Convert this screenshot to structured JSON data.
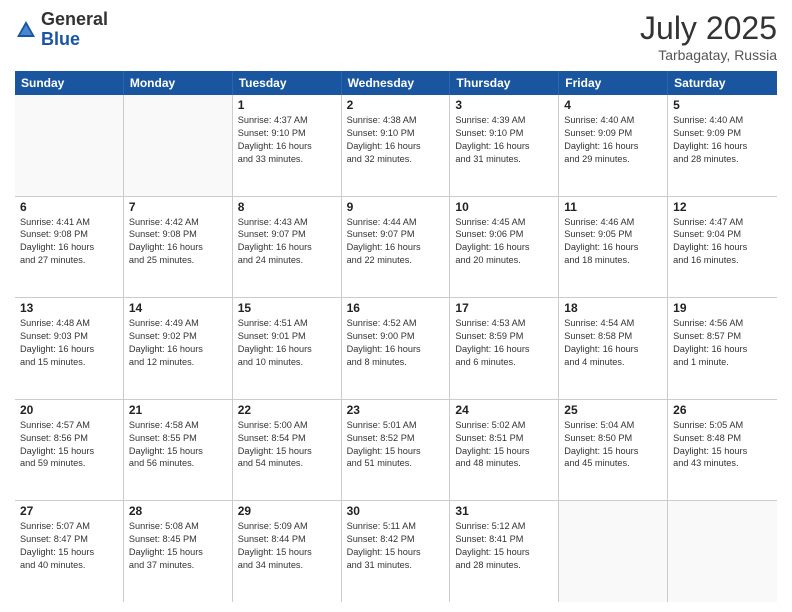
{
  "header": {
    "logo_general": "General",
    "logo_blue": "Blue",
    "month": "July 2025",
    "location": "Tarbagatay, Russia"
  },
  "days_of_week": [
    "Sunday",
    "Monday",
    "Tuesday",
    "Wednesday",
    "Thursday",
    "Friday",
    "Saturday"
  ],
  "weeks": [
    [
      {
        "day": "",
        "lines": []
      },
      {
        "day": "",
        "lines": []
      },
      {
        "day": "1",
        "lines": [
          "Sunrise: 4:37 AM",
          "Sunset: 9:10 PM",
          "Daylight: 16 hours",
          "and 33 minutes."
        ]
      },
      {
        "day": "2",
        "lines": [
          "Sunrise: 4:38 AM",
          "Sunset: 9:10 PM",
          "Daylight: 16 hours",
          "and 32 minutes."
        ]
      },
      {
        "day": "3",
        "lines": [
          "Sunrise: 4:39 AM",
          "Sunset: 9:10 PM",
          "Daylight: 16 hours",
          "and 31 minutes."
        ]
      },
      {
        "day": "4",
        "lines": [
          "Sunrise: 4:40 AM",
          "Sunset: 9:09 PM",
          "Daylight: 16 hours",
          "and 29 minutes."
        ]
      },
      {
        "day": "5",
        "lines": [
          "Sunrise: 4:40 AM",
          "Sunset: 9:09 PM",
          "Daylight: 16 hours",
          "and 28 minutes."
        ]
      }
    ],
    [
      {
        "day": "6",
        "lines": [
          "Sunrise: 4:41 AM",
          "Sunset: 9:08 PM",
          "Daylight: 16 hours",
          "and 27 minutes."
        ]
      },
      {
        "day": "7",
        "lines": [
          "Sunrise: 4:42 AM",
          "Sunset: 9:08 PM",
          "Daylight: 16 hours",
          "and 25 minutes."
        ]
      },
      {
        "day": "8",
        "lines": [
          "Sunrise: 4:43 AM",
          "Sunset: 9:07 PM",
          "Daylight: 16 hours",
          "and 24 minutes."
        ]
      },
      {
        "day": "9",
        "lines": [
          "Sunrise: 4:44 AM",
          "Sunset: 9:07 PM",
          "Daylight: 16 hours",
          "and 22 minutes."
        ]
      },
      {
        "day": "10",
        "lines": [
          "Sunrise: 4:45 AM",
          "Sunset: 9:06 PM",
          "Daylight: 16 hours",
          "and 20 minutes."
        ]
      },
      {
        "day": "11",
        "lines": [
          "Sunrise: 4:46 AM",
          "Sunset: 9:05 PM",
          "Daylight: 16 hours",
          "and 18 minutes."
        ]
      },
      {
        "day": "12",
        "lines": [
          "Sunrise: 4:47 AM",
          "Sunset: 9:04 PM",
          "Daylight: 16 hours",
          "and 16 minutes."
        ]
      }
    ],
    [
      {
        "day": "13",
        "lines": [
          "Sunrise: 4:48 AM",
          "Sunset: 9:03 PM",
          "Daylight: 16 hours",
          "and 15 minutes."
        ]
      },
      {
        "day": "14",
        "lines": [
          "Sunrise: 4:49 AM",
          "Sunset: 9:02 PM",
          "Daylight: 16 hours",
          "and 12 minutes."
        ]
      },
      {
        "day": "15",
        "lines": [
          "Sunrise: 4:51 AM",
          "Sunset: 9:01 PM",
          "Daylight: 16 hours",
          "and 10 minutes."
        ]
      },
      {
        "day": "16",
        "lines": [
          "Sunrise: 4:52 AM",
          "Sunset: 9:00 PM",
          "Daylight: 16 hours",
          "and 8 minutes."
        ]
      },
      {
        "day": "17",
        "lines": [
          "Sunrise: 4:53 AM",
          "Sunset: 8:59 PM",
          "Daylight: 16 hours",
          "and 6 minutes."
        ]
      },
      {
        "day": "18",
        "lines": [
          "Sunrise: 4:54 AM",
          "Sunset: 8:58 PM",
          "Daylight: 16 hours",
          "and 4 minutes."
        ]
      },
      {
        "day": "19",
        "lines": [
          "Sunrise: 4:56 AM",
          "Sunset: 8:57 PM",
          "Daylight: 16 hours",
          "and 1 minute."
        ]
      }
    ],
    [
      {
        "day": "20",
        "lines": [
          "Sunrise: 4:57 AM",
          "Sunset: 8:56 PM",
          "Daylight: 15 hours",
          "and 59 minutes."
        ]
      },
      {
        "day": "21",
        "lines": [
          "Sunrise: 4:58 AM",
          "Sunset: 8:55 PM",
          "Daylight: 15 hours",
          "and 56 minutes."
        ]
      },
      {
        "day": "22",
        "lines": [
          "Sunrise: 5:00 AM",
          "Sunset: 8:54 PM",
          "Daylight: 15 hours",
          "and 54 minutes."
        ]
      },
      {
        "day": "23",
        "lines": [
          "Sunrise: 5:01 AM",
          "Sunset: 8:52 PM",
          "Daylight: 15 hours",
          "and 51 minutes."
        ]
      },
      {
        "day": "24",
        "lines": [
          "Sunrise: 5:02 AM",
          "Sunset: 8:51 PM",
          "Daylight: 15 hours",
          "and 48 minutes."
        ]
      },
      {
        "day": "25",
        "lines": [
          "Sunrise: 5:04 AM",
          "Sunset: 8:50 PM",
          "Daylight: 15 hours",
          "and 45 minutes."
        ]
      },
      {
        "day": "26",
        "lines": [
          "Sunrise: 5:05 AM",
          "Sunset: 8:48 PM",
          "Daylight: 15 hours",
          "and 43 minutes."
        ]
      }
    ],
    [
      {
        "day": "27",
        "lines": [
          "Sunrise: 5:07 AM",
          "Sunset: 8:47 PM",
          "Daylight: 15 hours",
          "and 40 minutes."
        ]
      },
      {
        "day": "28",
        "lines": [
          "Sunrise: 5:08 AM",
          "Sunset: 8:45 PM",
          "Daylight: 15 hours",
          "and 37 minutes."
        ]
      },
      {
        "day": "29",
        "lines": [
          "Sunrise: 5:09 AM",
          "Sunset: 8:44 PM",
          "Daylight: 15 hours",
          "and 34 minutes."
        ]
      },
      {
        "day": "30",
        "lines": [
          "Sunrise: 5:11 AM",
          "Sunset: 8:42 PM",
          "Daylight: 15 hours",
          "and 31 minutes."
        ]
      },
      {
        "day": "31",
        "lines": [
          "Sunrise: 5:12 AM",
          "Sunset: 8:41 PM",
          "Daylight: 15 hours",
          "and 28 minutes."
        ]
      },
      {
        "day": "",
        "lines": []
      },
      {
        "day": "",
        "lines": []
      }
    ]
  ]
}
